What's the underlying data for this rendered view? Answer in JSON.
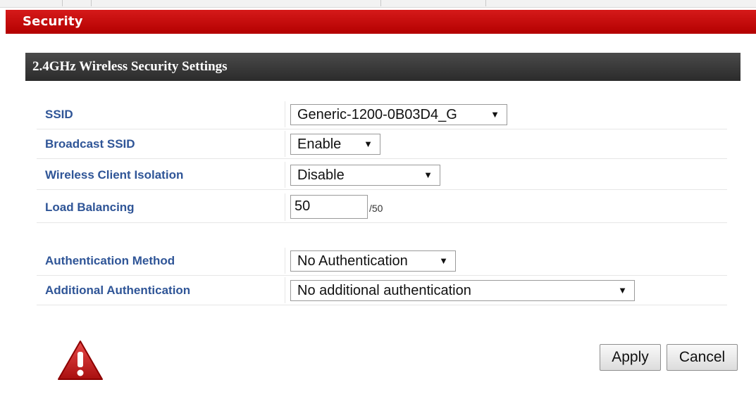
{
  "section_title": "Security",
  "panel_title": "2.4GHz Wireless Security Settings",
  "fields": {
    "ssid": {
      "label": "SSID",
      "value": "Generic-1200-0B03D4_G"
    },
    "broadcast_ssid": {
      "label": "Broadcast SSID",
      "value": "Enable"
    },
    "client_isolation": {
      "label": "Wireless Client Isolation",
      "value": "Disable"
    },
    "load_balancing": {
      "label": "Load Balancing",
      "value": "50",
      "suffix": "/50"
    },
    "auth_method": {
      "label": "Authentication Method",
      "value": "No Authentication"
    },
    "additional_auth": {
      "label": "Additional Authentication",
      "value": "No additional authentication"
    }
  },
  "buttons": {
    "apply": "Apply",
    "cancel": "Cancel"
  },
  "icons": {
    "warning": "warning-triangle-icon",
    "dropdown": "dropdown-arrow-icon"
  },
  "colors": {
    "section_bar": "#c40000",
    "panel_header": "#333333",
    "label": "#2f5597",
    "warning": "#cc1f1f"
  }
}
